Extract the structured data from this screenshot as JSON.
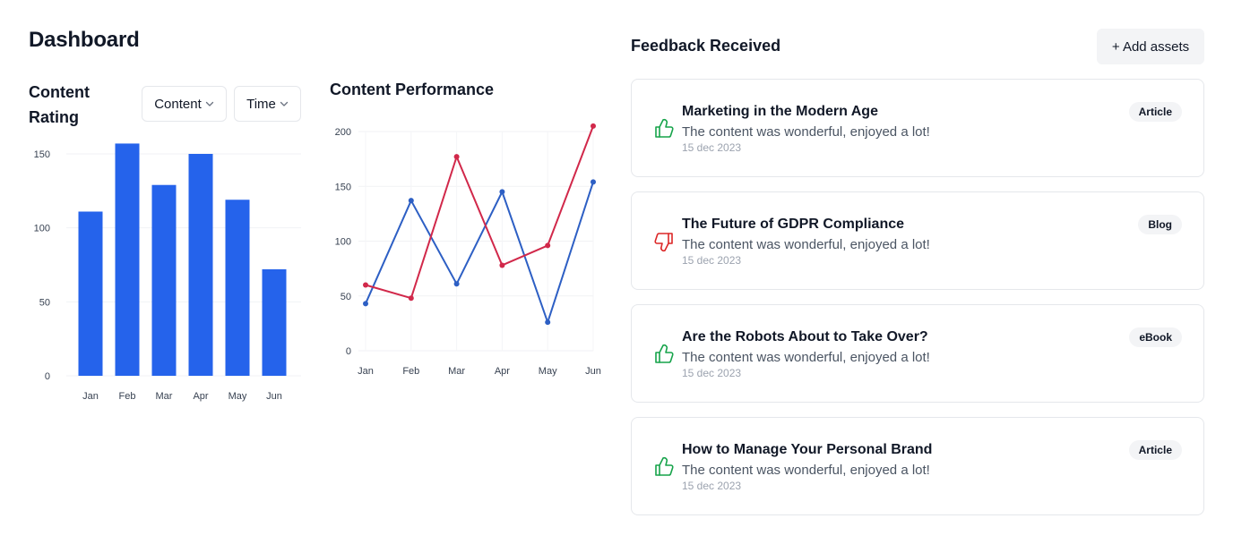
{
  "page": {
    "title": "Dashboard"
  },
  "rating": {
    "title": "Content Rating",
    "filters": [
      {
        "label": "Content",
        "icon": "chevron-down-icon"
      },
      {
        "label": "Time",
        "icon": "chevron-down-icon"
      }
    ]
  },
  "performance": {
    "title": "Content Performance"
  },
  "chart_data": [
    {
      "type": "bar",
      "categories": [
        "Jan",
        "Feb",
        "Mar",
        "Apr",
        "May",
        "Jun"
      ],
      "values": [
        111,
        157,
        129,
        150,
        119,
        72
      ],
      "title": "Content Rating",
      "ylim": [
        0,
        150
      ],
      "yticks": [
        0,
        50,
        100,
        150
      ],
      "grid": true,
      "color": "#2563eb"
    },
    {
      "type": "line",
      "categories": [
        "Jan",
        "Feb",
        "Mar",
        "Apr",
        "May",
        "Jun"
      ],
      "series": [
        {
          "values": [
            43,
            137,
            61,
            145,
            26,
            154
          ],
          "color": "#2d5fc4"
        },
        {
          "values": [
            60,
            48,
            177,
            78,
            96,
            205
          ],
          "color": "#d1284a"
        }
      ],
      "title": "Content Performance",
      "ylim": [
        0,
        200
      ],
      "yticks": [
        0,
        50,
        100,
        150,
        200
      ],
      "grid": true
    }
  ],
  "feedback": {
    "title": "Feedback Received",
    "add_button": "+ Add assets",
    "items": [
      {
        "title": "Marketing in the Modern Age",
        "desc": "The content was wonderful, enjoyed a lot!",
        "date": "15 dec 2023",
        "badge": "Article",
        "sentiment": "positive",
        "icon": "thumbs-up-icon"
      },
      {
        "title": "The Future of GDPR Compliance",
        "desc": "The content was wonderful, enjoyed a lot!",
        "date": "15 dec 2023",
        "badge": "Blog",
        "sentiment": "negative",
        "icon": "thumbs-down-icon"
      },
      {
        "title": "Are the Robots About to Take Over?",
        "desc": "The content was wonderful, enjoyed a lot!",
        "date": "15 dec 2023",
        "badge": "eBook",
        "sentiment": "positive",
        "icon": "thumbs-up-icon"
      },
      {
        "title": "How to Manage Your Personal Brand",
        "desc": "The content was wonderful, enjoyed a lot!",
        "date": "15 dec 2023",
        "badge": "Article",
        "sentiment": "positive",
        "icon": "thumbs-up-icon"
      }
    ],
    "colors": {
      "positive": "#16a34a",
      "negative": "#dc2626"
    }
  }
}
